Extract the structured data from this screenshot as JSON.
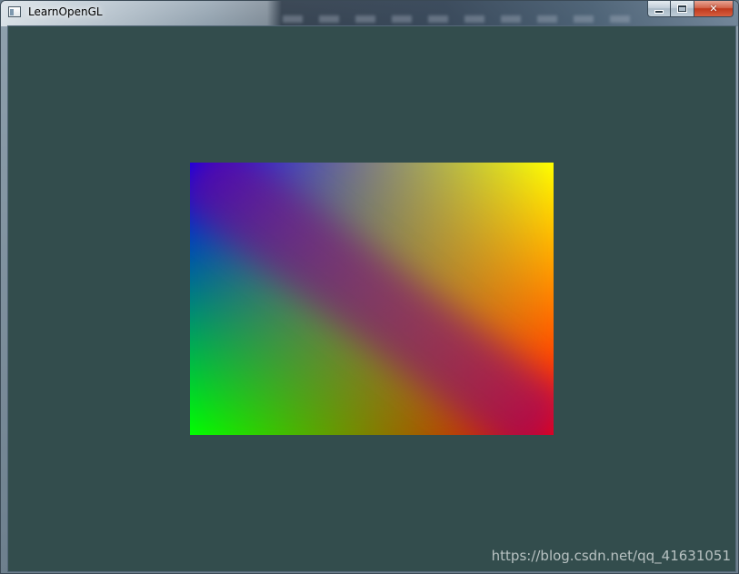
{
  "window": {
    "title": "LearnOpenGL",
    "icon": "app-window-icon",
    "caption_buttons": {
      "minimize": "minimize-icon",
      "maximize": "maximize-icon",
      "close_label": "✕"
    }
  },
  "canvas": {
    "clear_color": "#334d4d",
    "quad": {
      "corner_colors": {
        "top_left": "#0000ff",
        "top_right": "#ffff00",
        "bottom_left": "#00ff00",
        "bottom_right": "#ff0000"
      },
      "diagonal_color": "#800080"
    }
  },
  "watermark": {
    "text": "https://blog.csdn.net/qq_41631051"
  }
}
